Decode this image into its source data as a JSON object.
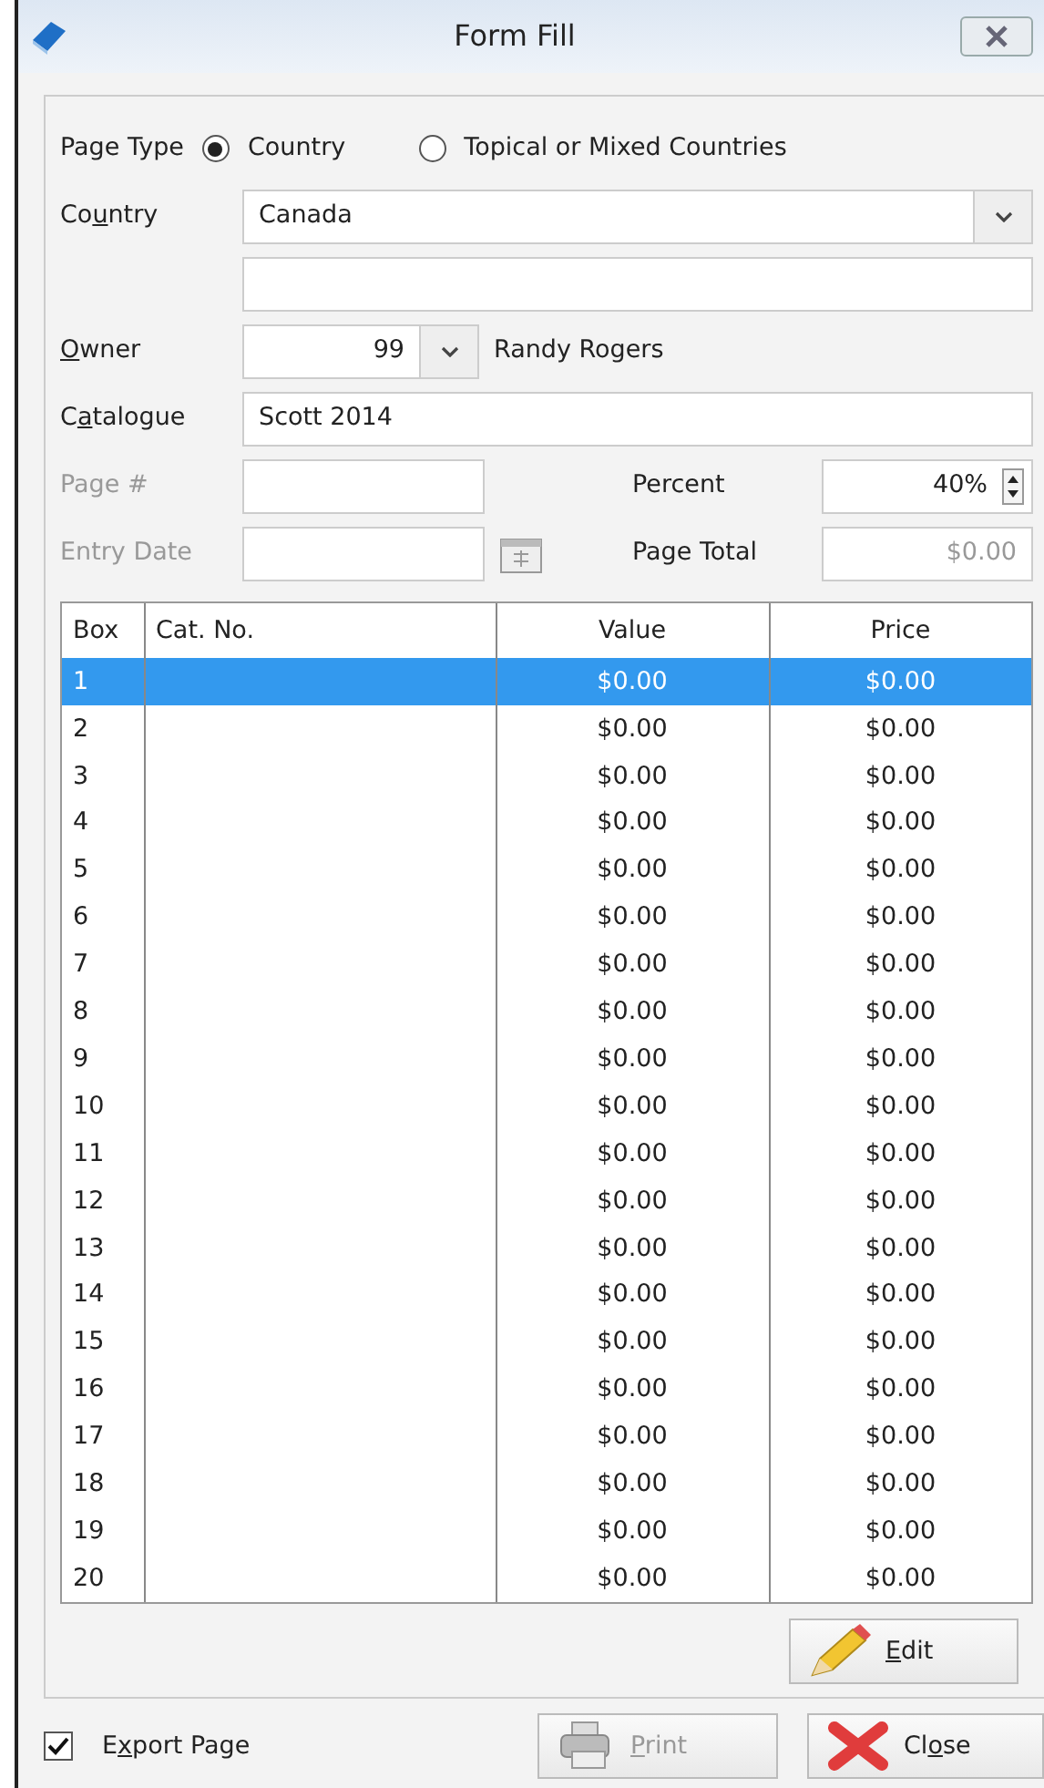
{
  "window": {
    "title": "Form Fill"
  },
  "page_type": {
    "label": "Page Type",
    "options": [
      {
        "label": "Country",
        "selected": true
      },
      {
        "label": "Topical or Mixed Countries",
        "selected": false
      }
    ]
  },
  "country": {
    "label_parts": [
      {
        "text": "Co",
        "underlined": false
      },
      {
        "text": "u",
        "underlined": true
      },
      {
        "text": "ntry",
        "underlined": false
      }
    ],
    "value": "Canada"
  },
  "owner": {
    "label_parts": [
      {
        "text": "O",
        "underlined": true
      },
      {
        "text": "wner",
        "underlined": false
      }
    ],
    "number": "99",
    "name": "Randy Rogers"
  },
  "catalogue": {
    "label_parts": [
      {
        "text": "C",
        "underlined": false
      },
      {
        "text": "a",
        "underlined": true
      },
      {
        "text": "talogue",
        "underlined": false
      }
    ],
    "value": "Scott 2014"
  },
  "page_number": {
    "label": "Page #",
    "disabled": true
  },
  "percent": {
    "label": "Percent",
    "value": "40%"
  },
  "entry_date": {
    "label": "Entry Date",
    "disabled": true
  },
  "page_total": {
    "label": "Page Total",
    "value": "$0.00",
    "disabled": true
  },
  "table": {
    "columns": [
      "Box",
      "Cat. No.",
      "Value",
      "Price"
    ],
    "rows": [
      {
        "cells": [
          "1",
          "",
          "$0.00",
          "$0.00"
        ],
        "selected": true
      },
      {
        "cells": [
          "2",
          "",
          "$0.00",
          "$0.00"
        ],
        "selected": false
      },
      {
        "cells": [
          "3",
          "",
          "$0.00",
          "$0.00"
        ],
        "selected": false
      },
      {
        "cells": [
          "4",
          "",
          "$0.00",
          "$0.00"
        ],
        "selected": false
      },
      {
        "cells": [
          "5",
          "",
          "$0.00",
          "$0.00"
        ],
        "selected": false
      },
      {
        "cells": [
          "6",
          "",
          "$0.00",
          "$0.00"
        ],
        "selected": false
      },
      {
        "cells": [
          "7",
          "",
          "$0.00",
          "$0.00"
        ],
        "selected": false
      },
      {
        "cells": [
          "8",
          "",
          "$0.00",
          "$0.00"
        ],
        "selected": false
      },
      {
        "cells": [
          "9",
          "",
          "$0.00",
          "$0.00"
        ],
        "selected": false
      },
      {
        "cells": [
          "10",
          "",
          "$0.00",
          "$0.00"
        ],
        "selected": false
      },
      {
        "cells": [
          "11",
          "",
          "$0.00",
          "$0.00"
        ],
        "selected": false
      },
      {
        "cells": [
          "12",
          "",
          "$0.00",
          "$0.00"
        ],
        "selected": false
      },
      {
        "cells": [
          "13",
          "",
          "$0.00",
          "$0.00"
        ],
        "selected": false
      },
      {
        "cells": [
          "14",
          "",
          "$0.00",
          "$0.00"
        ],
        "selected": false
      },
      {
        "cells": [
          "15",
          "",
          "$0.00",
          "$0.00"
        ],
        "selected": false
      },
      {
        "cells": [
          "16",
          "",
          "$0.00",
          "$0.00"
        ],
        "selected": false
      },
      {
        "cells": [
          "17",
          "",
          "$0.00",
          "$0.00"
        ],
        "selected": false
      },
      {
        "cells": [
          "18",
          "",
          "$0.00",
          "$0.00"
        ],
        "selected": false
      },
      {
        "cells": [
          "19",
          "",
          "$0.00",
          "$0.00"
        ],
        "selected": false
      },
      {
        "cells": [
          "20",
          "",
          "$0.00",
          "$0.00"
        ],
        "selected": false
      }
    ]
  },
  "edit_button": {
    "label_parts": [
      {
        "text": "E",
        "underlined": true
      },
      {
        "text": "dit",
        "underlined": false
      }
    ]
  },
  "export_page": {
    "label_parts": [
      {
        "text": "E",
        "underlined": false
      },
      {
        "text": "x",
        "underlined": true
      },
      {
        "text": "port Page",
        "underlined": false
      }
    ],
    "checked": true
  },
  "print_button": {
    "label_parts": [
      {
        "text": "P",
        "underlined": true
      },
      {
        "text": "rint",
        "underlined": false
      }
    ],
    "disabled": true
  },
  "close_button": {
    "label_parts": [
      {
        "text": "Cl",
        "underlined": false
      },
      {
        "text": "o",
        "underlined": true
      },
      {
        "text": "se",
        "underlined": false
      }
    ]
  }
}
